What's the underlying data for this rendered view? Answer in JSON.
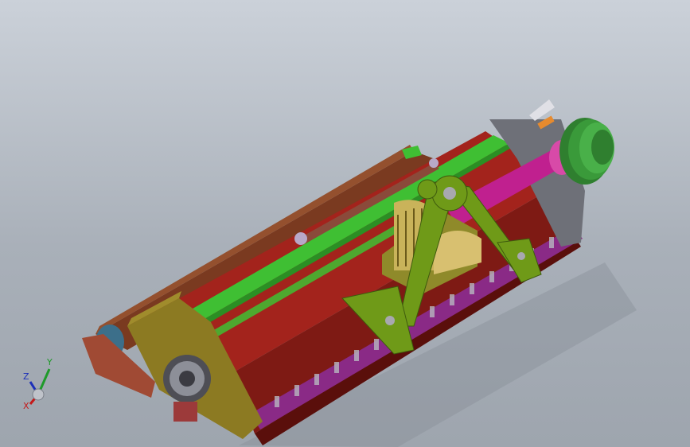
{
  "viewport": {
    "background_top": "#cbd1d9",
    "background_bottom": "#9ea5ae"
  },
  "model": {
    "name": "flail-mower-assembly",
    "colors": {
      "housing_red": "#a3231c",
      "housing_dark": "#6e140f",
      "top_cover_brown": "#7a3a20",
      "end_plate_olive": "#8c7a22",
      "frame_green": "#6f9a18",
      "bar_green": "#3fbf33",
      "shaft_magenta": "#c0208f",
      "pulley_green": "#3a9a3a",
      "skid_purple": "#8a2a86",
      "gearbox_olive": "#8f8a2a"
    }
  },
  "triad": {
    "x_label": "X",
    "y_label": "Y",
    "z_label": "Z",
    "x_color": "#c41919",
    "y_color": "#1f9a2a",
    "z_color": "#1c2fb8"
  }
}
